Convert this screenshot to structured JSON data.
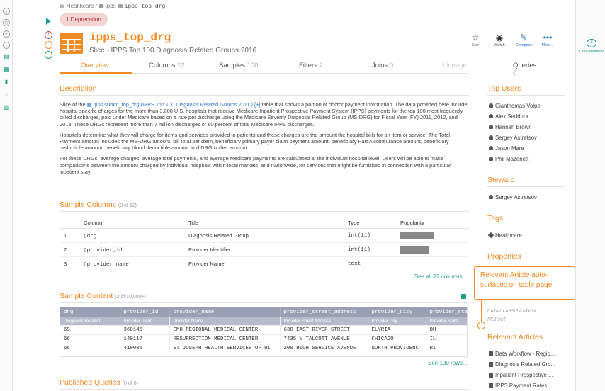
{
  "breadcrumb": {
    "root": "Healthcare",
    "sep": "/",
    "schema": "ipps",
    "table": "ipps_top_drg"
  },
  "deprecation": "1 Deprecation",
  "title": "ipps_top_drg",
  "subtitle": "Slice - IPPS Top 100 Diagnosis Related Groups 2016",
  "actions": {
    "star": "Star",
    "watch": "Watch",
    "compose": "Compose",
    "more": "More..."
  },
  "conversations": {
    "count": "3",
    "label": "Conversations"
  },
  "rail_status": {
    "c1": "1",
    "c2": "0",
    "c3": "0"
  },
  "tabs": [
    {
      "label": "Overview",
      "count": ""
    },
    {
      "label": "Columns",
      "count": "12"
    },
    {
      "label": "Samples",
      "count": "100"
    },
    {
      "label": "Filters",
      "count": "2"
    },
    {
      "label": "Joins",
      "count": "0"
    },
    {
      "label": "Lineage",
      "count": ""
    },
    {
      "label": "Queries",
      "count": "0"
    }
  ],
  "description": {
    "heading": "Description",
    "p1_prefix": "Slice of the",
    "p1_link": "ipps.summ_top_drg (IPPS Top 100 Diagnosis Related Groups 2011 )",
    "p1_plus": "[+]",
    "p1_rest": "table that shows a portion of doctor payment information. The data provided here include hospital-specific charges for the more than 3,000 U.S. hospitals that receive Medicare Inpatient Prospective Payment System (IPPS) payments for the top 100 most frequently billed discharges, paid under Medicare based on a rate per discharge using the Medicare Severity Diagnosis Related Group (MS-DRG) for Fiscal Year (FY) 2011, 2012, and 2013. These DRGs represent more than 7 million discharges or 60 percent of total Medicare IPPS discharges.",
    "p2": "Hospitals determine what they will charge for items and services provided to patients and these charges are the amount the hospital bills for an item or service. The Total Payment amount includes the MS-DRG amount, bill total per diem, beneficiary primary payer claim payment amount, beneficiary Part A coinsurance amount, beneficiary deductible amount, beneficiary blood deductible amount and DRG outlier amount.",
    "p3": "For these DRGs, average charges, average total payments, and average Medicare payments are calculated at the individual hospital level. Users will be able to make comparisons between the amount charged by individual hospitals within local markets, and nationwide, for services that might be furnished in connection with a particular inpatient stay."
  },
  "sample_columns": {
    "heading": "Sample Columns",
    "count": "(3 of 12)",
    "headers": [
      "Column",
      "Title",
      "Type",
      "Popularity"
    ],
    "rows": [
      {
        "n": "1",
        "col": "drg",
        "title": "Diagnosis Related Group",
        "type": "int(11)",
        "pop": 0.85
      },
      {
        "n": "2",
        "col": "provider_id",
        "title": "Provider Identifier",
        "type": "int(11)",
        "pop": 0.72
      },
      {
        "n": "3",
        "col": "provider_name",
        "title": "Provider Name",
        "type": "text",
        "pop": 0
      }
    ],
    "see_all": "See all 12 columns..."
  },
  "sample_content": {
    "heading": "Sample Content",
    "count": "(3 of 10,000+)",
    "headers": [
      "drg",
      "provider_id",
      "provider_name",
      "provider_street_address",
      "provider_city",
      "provider_state"
    ],
    "subheaders": [
      "Diagnosis Related ...",
      "Provider Identi...",
      "Provider Name",
      "Provider Street Address",
      "Provider City",
      "Provider State"
    ],
    "rows": [
      [
        "69",
        "360145",
        "EMH REGIONAL MEDICAL CENTER",
        "630 EAST RIVER STREET",
        "ELYRIA",
        "OH"
      ],
      [
        "66",
        "140117",
        "RESURRECTION MEDICAL CENTER",
        "7435 W TALCOTT AVENUE",
        "CHICAGO",
        "IL"
      ],
      [
        "66",
        "410005",
        "ST JOSEPH HEALTH SERVICES OF RI",
        "200 HIGH SERVICE AVENUE",
        "NORTH PROVIDENC",
        "RI"
      ]
    ],
    "see_rows": "See 100 rows..."
  },
  "published_queries": {
    "heading": "Published Queries",
    "count": "(0 of 0)"
  },
  "top_users": {
    "heading": "Top Users",
    "users": [
      "Gianthomas Volpe",
      "Alex Seddura",
      "Hannah Brown",
      "Sergey Astretsov",
      "Jason Mara",
      "Phil Mazenett"
    ]
  },
  "steward": {
    "heading": "Steward",
    "name": "Sergey Astretsov"
  },
  "tags": {
    "heading": "Tags",
    "items": [
      "Healthcare"
    ]
  },
  "properties": {
    "heading": "Properties",
    "data_classification_label": "DATA CLASSIFICATION",
    "data_classification_value": "Not set"
  },
  "callout": "Relevant Article auto-surfaces on table page",
  "relevant_articles": {
    "heading": "Relevant Articles",
    "items": [
      "Data Workflow - Regio...",
      "Diagnosis Related Gro...",
      "Inpatient Prospective ...",
      "IPPS Payment Rates"
    ]
  },
  "colors": {
    "accent": "#f08a24",
    "teal": "#1a9c8c",
    "link": "#2a72c8"
  }
}
